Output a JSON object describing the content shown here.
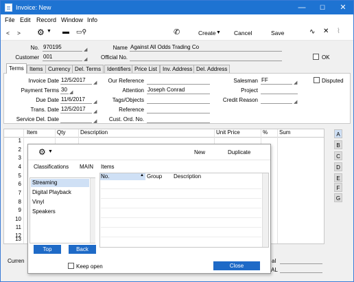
{
  "window": {
    "title": "Invoice: New",
    "minimize": "—",
    "maximize": "☐",
    "close": "✕"
  },
  "menu": [
    "File",
    "Edit",
    "Record",
    "Window",
    "Info"
  ],
  "toolbar": {
    "create": "Create",
    "cancel": "Cancel",
    "save": "Save"
  },
  "header": {
    "no_label": "No.",
    "no_value": "970195",
    "name_label": "Name",
    "name_value": "Against All Odds Trading Co",
    "customer_label": "Customer",
    "customer_value": "001",
    "official_label": "Official No.",
    "official_value": "",
    "ok_label": "OK"
  },
  "tabs": [
    "Terms",
    "Items",
    "Currency",
    "Del. Terms",
    "Identifiers",
    "Price List",
    "Inv. Address",
    "Del. Address"
  ],
  "terms": {
    "invoice_date_label": "Invoice Date",
    "invoice_date": "12/5/2017",
    "payment_terms_label": "Payment Terms",
    "payment_terms": "30",
    "due_date_label": "Due Date",
    "due_date": "11/6/2017",
    "trans_date_label": "Trans. Date",
    "trans_date": "12/5/2017",
    "service_del_label": "Service Del. Date",
    "service_del": "",
    "our_ref_label": "Our Reference",
    "our_ref": "",
    "attention_label": "Attention",
    "attention": "Joseph Conrad",
    "tags_label": "Tags/Objects",
    "tags": "",
    "reference_label": "Reference",
    "reference": "",
    "cust_ord_label": "Cust. Ord. No.",
    "cust_ord": "",
    "salesman_label": "Salesman",
    "salesman": "FF",
    "project_label": "Project",
    "project": "",
    "credit_reason_label": "Credit Reason",
    "credit_reason": "",
    "disputed_label": "Disputed"
  },
  "matrix": {
    "columns": [
      "Item",
      "Qty",
      "Description",
      "Unit Price",
      "%",
      "Sum"
    ],
    "rows": [
      "1",
      "2",
      "3",
      "4",
      "5",
      "6",
      "7",
      "8",
      "9",
      "10",
      "11",
      "12",
      "13"
    ],
    "letters": [
      "A",
      "B",
      "C",
      "D",
      "E",
      "F",
      "G"
    ]
  },
  "footer": {
    "currency_label": "Curren",
    "right_label_1": "al",
    "right_label_2": "AL"
  },
  "popup": {
    "new": "New",
    "duplicate": "Duplicate",
    "classifications": "Classifications",
    "main": "MAIN",
    "items": "Items",
    "list": [
      "Streaming",
      "Digital Playback",
      "Vinyl",
      "Speakers"
    ],
    "selected": "Streaming",
    "grid_cols": [
      "No.",
      "Group",
      "Description"
    ],
    "top": "Top",
    "back": "Back",
    "keep_open": "Keep open",
    "close": "Close"
  },
  "colors": {
    "title_bar": "#1e73d2",
    "accent_button": "#1e6ac7",
    "selected_item": "#cfe0f5"
  }
}
